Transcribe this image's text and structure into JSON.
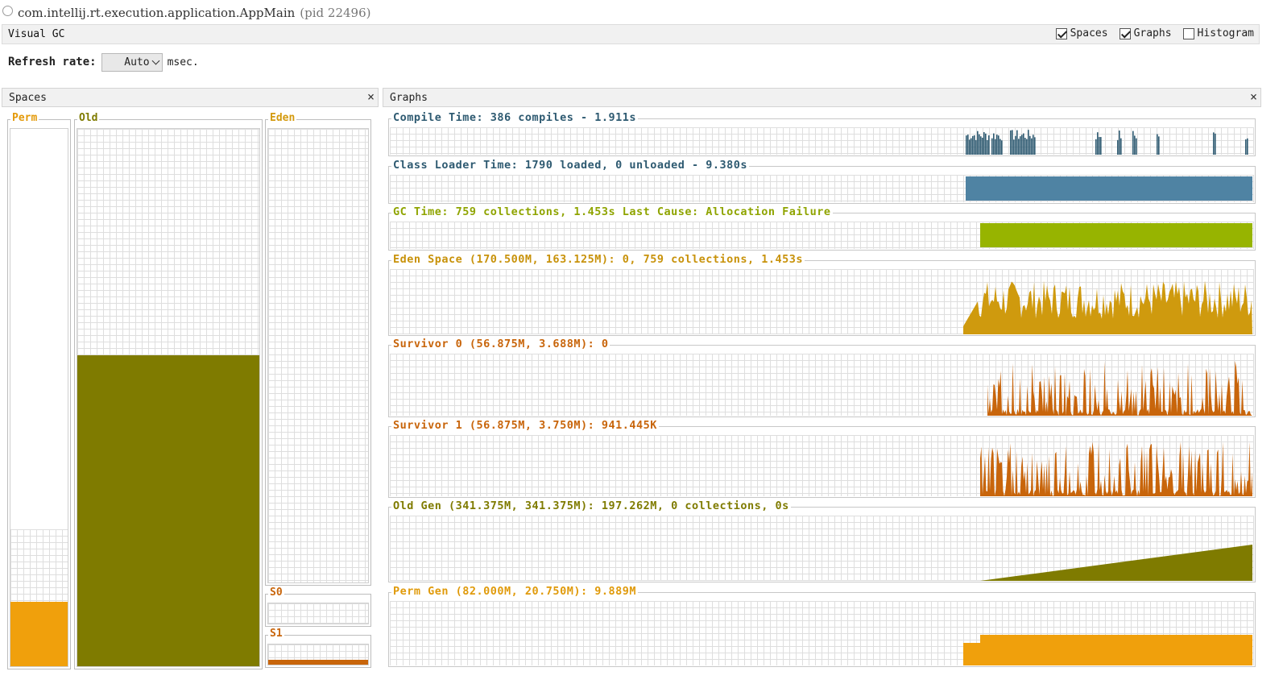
{
  "window": {
    "title": "com.intellij.rt.execution.application.AppMain",
    "pid": "(pid 22496)"
  },
  "toolbar": {
    "title": "Visual GC",
    "checks": [
      {
        "label": "Spaces",
        "checked": true
      },
      {
        "label": "Graphs",
        "checked": true
      },
      {
        "label": "Histogram",
        "checked": false
      }
    ]
  },
  "refresh": {
    "label": "Refresh rate:",
    "value": "Auto",
    "unit": "msec."
  },
  "spaces": {
    "title": "Spaces",
    "close": "×",
    "perm": {
      "label": "Perm",
      "used_fraction": 0.12
    },
    "old": {
      "label": "Old",
      "used_fraction": 0.578
    },
    "eden": {
      "label": "Eden",
      "used_fraction": 0.0
    },
    "s0": {
      "label": "S0",
      "used_fraction": 0.0
    },
    "s1": {
      "label": "S1",
      "used_fraction": 0.25
    }
  },
  "graphs": {
    "title": "Graphs",
    "close": "×",
    "rows": [
      {
        "key": "compile",
        "label": "Compile Time: 386 compiles - 1.911s",
        "color": "#2e5a71",
        "fill": "#2e5a71",
        "kind": "spikes"
      },
      {
        "key": "classloader",
        "label": "Class Loader Time: 1790 loaded, 0 unloaded - 9.380s",
        "color": "#2e5a71",
        "fill": "#4f83a3",
        "kind": "block"
      },
      {
        "key": "gc",
        "label": "GC Time: 759 collections, 1.453s  Last Cause: Allocation Failure",
        "color": "#8fa400",
        "fill": "#97b400",
        "kind": "block"
      },
      {
        "key": "eden",
        "label": "Eden Space (170.500M, 163.125M): 0, 759 collections, 1.453s",
        "color": "#c8920a",
        "fill": "#cf9a0e",
        "kind": "noise"
      },
      {
        "key": "s0",
        "label": "Survivor 0 (56.875M, 3.688M): 0",
        "color": "#c8650b",
        "fill": "#c8650b",
        "kind": "spikes2"
      },
      {
        "key": "s1",
        "label": "Survivor 1 (56.875M, 3.750M): 941.445K",
        "color": "#c8650b",
        "fill": "#c8650b",
        "kind": "spikes3"
      },
      {
        "key": "old",
        "label": "Old Gen (341.375M, 341.375M): 197.262M, 0 collections, 0s",
        "color": "#7f7b00",
        "fill": "#7f7b00",
        "kind": "ramp"
      },
      {
        "key": "perm",
        "label": "Perm Gen (82.000M, 20.750M): 9.889M",
        "color": "#e09a0a",
        "fill": "#f0a00c",
        "kind": "perm"
      }
    ]
  }
}
